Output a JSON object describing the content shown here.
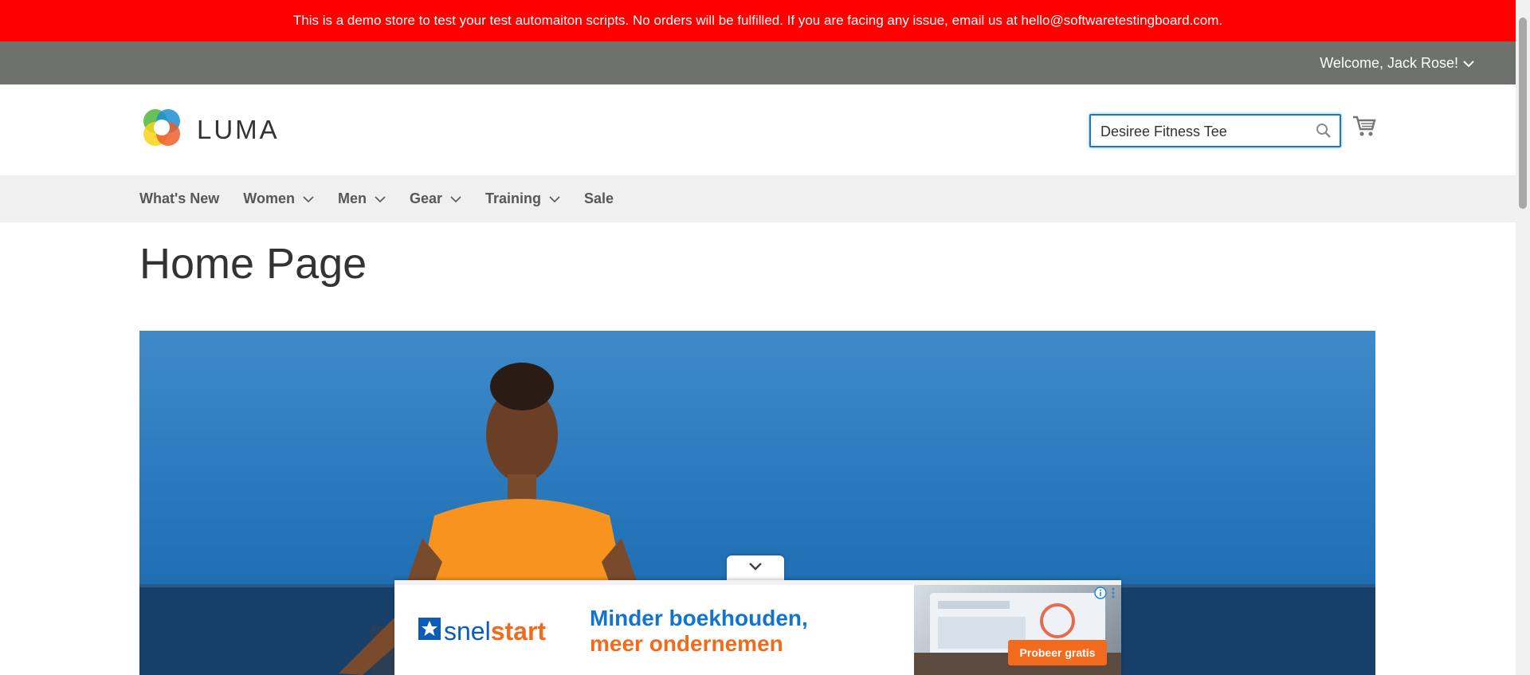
{
  "demo_notice": "This is a demo store to test your test automaiton scripts. No orders will be fulfilled. If you are facing any issue, email us at hello@softwaretestingboard.com.",
  "header": {
    "welcome": "Welcome, Jack Rose!",
    "logo_text": "LUMA",
    "search": {
      "value": "Desiree Fitness Tee"
    }
  },
  "nav": {
    "items": [
      {
        "label": "What's New",
        "has_dropdown": false
      },
      {
        "label": "Women",
        "has_dropdown": true
      },
      {
        "label": "Men",
        "has_dropdown": true
      },
      {
        "label": "Gear",
        "has_dropdown": true
      },
      {
        "label": "Training",
        "has_dropdown": true
      },
      {
        "label": "Sale",
        "has_dropdown": false
      }
    ]
  },
  "main": {
    "page_title": "Home Page"
  },
  "ad": {
    "brand_plain": "snel",
    "brand_accent": "start",
    "headline_1": "Minder boekhouden,",
    "headline_2": "meer ondernemen",
    "cta": "Probeer gratis"
  },
  "colors": {
    "notice_bg": "#ff0000",
    "panel_bg": "#6e716e",
    "nav_bg": "#f0f0f0",
    "search_border": "#1979c3",
    "ad_blue": "#1273d1",
    "ad_orange": "#f26b1d"
  },
  "icons": [
    "chevron-down-icon",
    "luma-logo-icon",
    "search-icon",
    "cart-icon",
    "info-icon",
    "more-icon"
  ]
}
